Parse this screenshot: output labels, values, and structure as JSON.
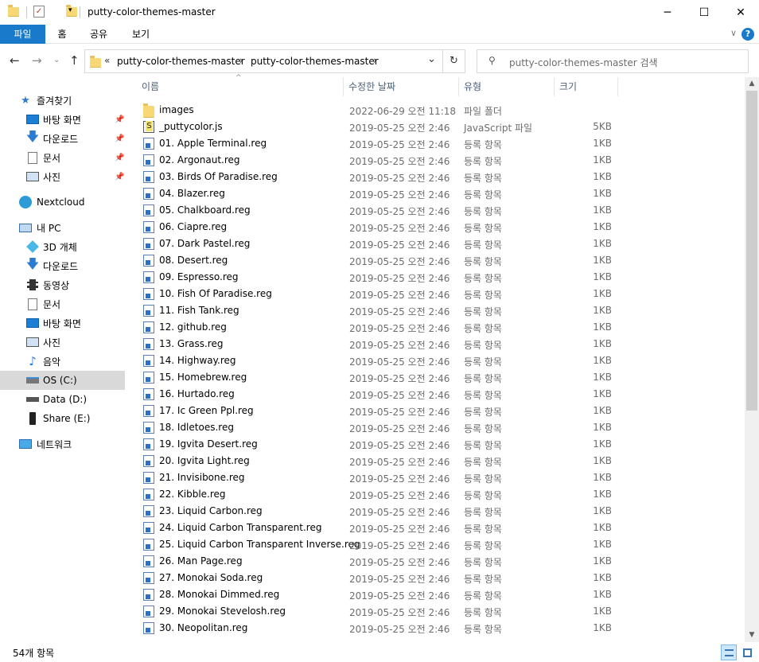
{
  "window": {
    "title": "putty-color-themes-master",
    "minimize": "─",
    "maximize": "☐",
    "close": "✕"
  },
  "ribbon": {
    "tabs": [
      "파일",
      "홈",
      "공유",
      "보기"
    ],
    "help": "?",
    "expand": "∨"
  },
  "address": {
    "overflow": "«",
    "segments": [
      "putty-color-themes-master",
      "putty-color-themes-master"
    ],
    "separator": "›",
    "dropdown": "⌄",
    "refresh": "↻"
  },
  "search": {
    "placeholder": "putty-color-themes-master 검색",
    "icon": "⚲"
  },
  "nav": {
    "back": "←",
    "forward": "→",
    "recent": "⌄",
    "up": "↑"
  },
  "sidebar": {
    "quick_access": "즐겨찾기",
    "quick_items": [
      "바탕 화면",
      "다운로드",
      "문서",
      "사진"
    ],
    "nextcloud": "Nextcloud",
    "this_pc": "내 PC",
    "pc_items": [
      "3D 개체",
      "다운로드",
      "동영상",
      "문서",
      "바탕 화면",
      "사진",
      "음악",
      "OS (C:)",
      "Data (D:)",
      "Share (E:)"
    ],
    "network": "네트워크"
  },
  "columns": {
    "name": "이름",
    "date": "수정한 날짜",
    "type": "유형",
    "size": "크기",
    "sort_indicator": "^"
  },
  "files": [
    {
      "name": "images",
      "date": "2022-06-29 오전 11:18",
      "type": "파일 폴더",
      "size": "",
      "kind": "folder"
    },
    {
      "name": "_puttycolor.js",
      "date": "2019-05-25 오전 2:46",
      "type": "JavaScript 파일",
      "size": "5KB",
      "kind": "js"
    },
    {
      "name": "01. Apple Terminal.reg",
      "date": "2019-05-25 오전 2:46",
      "type": "등록 항목",
      "size": "1KB",
      "kind": "reg"
    },
    {
      "name": "02. Argonaut.reg",
      "date": "2019-05-25 오전 2:46",
      "type": "등록 항목",
      "size": "1KB",
      "kind": "reg"
    },
    {
      "name": "03. Birds Of Paradise.reg",
      "date": "2019-05-25 오전 2:46",
      "type": "등록 항목",
      "size": "1KB",
      "kind": "reg"
    },
    {
      "name": "04. Blazer.reg",
      "date": "2019-05-25 오전 2:46",
      "type": "등록 항목",
      "size": "1KB",
      "kind": "reg"
    },
    {
      "name": "05. Chalkboard.reg",
      "date": "2019-05-25 오전 2:46",
      "type": "등록 항목",
      "size": "1KB",
      "kind": "reg"
    },
    {
      "name": "06. Ciapre.reg",
      "date": "2019-05-25 오전 2:46",
      "type": "등록 항목",
      "size": "1KB",
      "kind": "reg"
    },
    {
      "name": "07. Dark Pastel.reg",
      "date": "2019-05-25 오전 2:46",
      "type": "등록 항목",
      "size": "1KB",
      "kind": "reg"
    },
    {
      "name": "08. Desert.reg",
      "date": "2019-05-25 오전 2:46",
      "type": "등록 항목",
      "size": "1KB",
      "kind": "reg"
    },
    {
      "name": "09. Espresso.reg",
      "date": "2019-05-25 오전 2:46",
      "type": "등록 항목",
      "size": "1KB",
      "kind": "reg"
    },
    {
      "name": "10. Fish Of Paradise.reg",
      "date": "2019-05-25 오전 2:46",
      "type": "등록 항목",
      "size": "1KB",
      "kind": "reg"
    },
    {
      "name": "11. Fish Tank.reg",
      "date": "2019-05-25 오전 2:46",
      "type": "등록 항목",
      "size": "1KB",
      "kind": "reg"
    },
    {
      "name": "12. github.reg",
      "date": "2019-05-25 오전 2:46",
      "type": "등록 항목",
      "size": "1KB",
      "kind": "reg"
    },
    {
      "name": "13. Grass.reg",
      "date": "2019-05-25 오전 2:46",
      "type": "등록 항목",
      "size": "1KB",
      "kind": "reg"
    },
    {
      "name": "14. Highway.reg",
      "date": "2019-05-25 오전 2:46",
      "type": "등록 항목",
      "size": "1KB",
      "kind": "reg"
    },
    {
      "name": "15. Homebrew.reg",
      "date": "2019-05-25 오전 2:46",
      "type": "등록 항목",
      "size": "1KB",
      "kind": "reg"
    },
    {
      "name": "16. Hurtado.reg",
      "date": "2019-05-25 오전 2:46",
      "type": "등록 항목",
      "size": "1KB",
      "kind": "reg"
    },
    {
      "name": "17. Ic Green Ppl.reg",
      "date": "2019-05-25 오전 2:46",
      "type": "등록 항목",
      "size": "1KB",
      "kind": "reg"
    },
    {
      "name": "18. Idletoes.reg",
      "date": "2019-05-25 오전 2:46",
      "type": "등록 항목",
      "size": "1KB",
      "kind": "reg"
    },
    {
      "name": "19. Igvita Desert.reg",
      "date": "2019-05-25 오전 2:46",
      "type": "등록 항목",
      "size": "1KB",
      "kind": "reg"
    },
    {
      "name": "20. Igvita Light.reg",
      "date": "2019-05-25 오전 2:46",
      "type": "등록 항목",
      "size": "1KB",
      "kind": "reg"
    },
    {
      "name": "21. Invisibone.reg",
      "date": "2019-05-25 오전 2:46",
      "type": "등록 항목",
      "size": "1KB",
      "kind": "reg"
    },
    {
      "name": "22. Kibble.reg",
      "date": "2019-05-25 오전 2:46",
      "type": "등록 항목",
      "size": "1KB",
      "kind": "reg"
    },
    {
      "name": "23. Liquid Carbon.reg",
      "date": "2019-05-25 오전 2:46",
      "type": "등록 항목",
      "size": "1KB",
      "kind": "reg"
    },
    {
      "name": "24. Liquid Carbon Transparent.reg",
      "date": "2019-05-25 오전 2:46",
      "type": "등록 항목",
      "size": "1KB",
      "kind": "reg"
    },
    {
      "name": "25. Liquid Carbon Transparent Inverse.reg",
      "date": "2019-05-25 오전 2:46",
      "type": "등록 항목",
      "size": "1KB",
      "kind": "reg"
    },
    {
      "name": "26. Man Page.reg",
      "date": "2019-05-25 오전 2:46",
      "type": "등록 항목",
      "size": "1KB",
      "kind": "reg"
    },
    {
      "name": "27. Monokai Soda.reg",
      "date": "2019-05-25 오전 2:46",
      "type": "등록 항목",
      "size": "1KB",
      "kind": "reg"
    },
    {
      "name": "28. Monokai Dimmed.reg",
      "date": "2019-05-25 오전 2:46",
      "type": "등록 항목",
      "size": "1KB",
      "kind": "reg"
    },
    {
      "name": "29. Monokai Stevelosh.reg",
      "date": "2019-05-25 오전 2:46",
      "type": "등록 항목",
      "size": "1KB",
      "kind": "reg"
    },
    {
      "name": "30. Neopolitan.reg",
      "date": "2019-05-25 오전 2:46",
      "type": "등록 항목",
      "size": "1KB",
      "kind": "reg"
    }
  ],
  "status": {
    "item_count": "54개 항목"
  },
  "colors": {
    "accent": "#1979ca",
    "selection": "#d9d9d9",
    "folder": "#f8d775"
  }
}
